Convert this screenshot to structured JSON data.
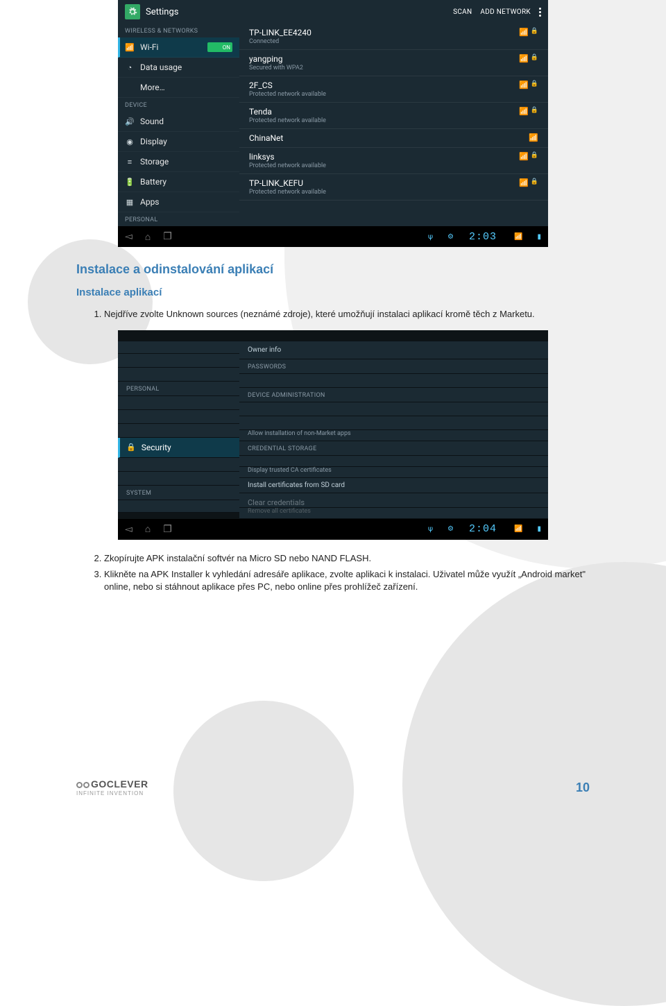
{
  "screenshot1": {
    "header": {
      "title": "Settings",
      "action_scan": "SCAN",
      "action_add": "ADD NETWORK"
    },
    "sidebar": {
      "cat_wireless": "WIRELESS & NETWORKS",
      "wifi": "Wi-Fi",
      "wifi_toggle": "ON",
      "data_usage": "Data usage",
      "more": "More…",
      "cat_device": "DEVICE",
      "sound": "Sound",
      "display": "Display",
      "storage": "Storage",
      "battery": "Battery",
      "apps": "Apps",
      "cat_personal": "PERSONAL"
    },
    "networks": [
      {
        "name": "TP-LINK_EE4240",
        "sub": "Connected",
        "locked": true
      },
      {
        "name": "yangping",
        "sub": "Secured with WPA2",
        "locked": true
      },
      {
        "name": "2F_CS",
        "sub": "Protected network available",
        "locked": true
      },
      {
        "name": "Tenda",
        "sub": "Protected network available",
        "locked": true
      },
      {
        "name": "ChinaNet",
        "sub": "",
        "locked": false
      },
      {
        "name": "linksys",
        "sub": "Protected network available",
        "locked": true
      },
      {
        "name": "TP-LINK_KEFU",
        "sub": "Protected network available",
        "locked": true
      }
    ],
    "navbar": {
      "clock": "2:03"
    }
  },
  "doc": {
    "heading1": "Instalace a odinstalování aplikací",
    "heading2": "Instalace aplikací",
    "step1": "Nejdříve zvolte Unknown sources (neznámé zdroje), které umožňují instalaci aplikací kromě těch z Marketu.",
    "step2": "Zkopírujte APK instalační softvér na Micro SD nebo NAND FLASH.",
    "step3": "Klikněte na APK Installer k vyhledání adresáře aplikace, zvolte aplikaci k instalaci. Uživatel může využít „Android market\" online, nebo si stáhnout aplikace přes PC, nebo online přes prohlížeč zařízení."
  },
  "screenshot2": {
    "left": {
      "cat_personal": "PERSONAL",
      "security": "Security",
      "cat_system": "SYSTEM"
    },
    "right": {
      "owner_info": "Owner info",
      "cat_passwords": "PASSWORDS",
      "cat_device_admin": "DEVICE ADMINISTRATION",
      "unknown_sub": "Allow installation of non-Market apps",
      "cat_cred": "CREDENTIAL STORAGE",
      "trusted_sub": "Display trusted CA certificates",
      "install_sd": "Install certificates from SD card",
      "clear_cred": "Clear credentials",
      "clear_cred_sub": "Remove all certificates"
    },
    "navbar": {
      "clock": "2:04"
    }
  },
  "footer": {
    "brand": "GOCLEVER",
    "tagline": "INFINITE INVENTION",
    "page_number": "10"
  }
}
